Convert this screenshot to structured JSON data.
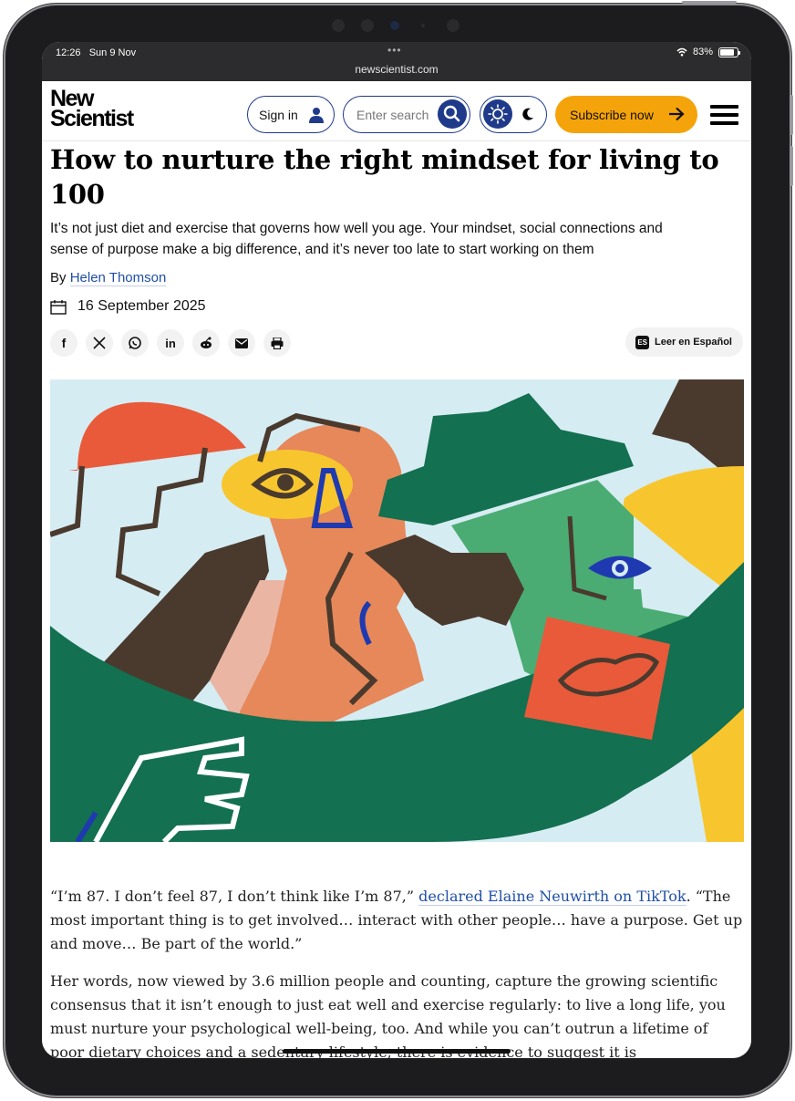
{
  "status_bar": {
    "time": "12:26",
    "date": "Sun 9 Nov",
    "battery": "83%",
    "battery_level": 0.83,
    "url": "newscientist.com"
  },
  "header": {
    "logo_line1": "New",
    "logo_line2": "Scientist",
    "sign_in": "Sign in",
    "search_placeholder": "Enter search",
    "subscribe": "Subscribe now"
  },
  "article": {
    "headline": "How to nurture the right mindset for living to 100",
    "standfirst": "It’s not just diet and exercise that governs how well you age. Your mindset, social connections and sense of purpose make a big difference, and it’s never too late to start working on them",
    "byline_prefix": "By",
    "author": "Helen Thomson",
    "date": "16 September 2025",
    "share_icons": [
      "facebook-icon",
      "x-icon",
      "whatsapp-icon",
      "linkedin-icon",
      "reddit-icon",
      "email-icon",
      "print-icon"
    ],
    "spanish_badge": "ES",
    "spanish_label": "Leer en Español",
    "para1_before": "“I’m 87. I don’t feel 87, I don’t think like I’m 87,”",
    "para1_link": "declared Elaine Neuwirth on TikTok",
    "para1_after": ". “The most important thing is to get involved… interact with other people… have a purpose. Get up and move… Be part of the world.”",
    "para2": "Her words, now viewed by 3.6 million people and counting, capture the growing scientific consensus that it isn’t enough to just eat well and exercise regularly: to live a long life, you must nurture your psychological well-being, too. And while you can’t outrun a lifetime of poor dietary choices and a sedentary lifestyle, there is evidence to suggest it is"
  },
  "colors": {
    "brand_blue": "#1f3a8a",
    "subscribe_orange": "#f5a30a",
    "link_blue": "#1f4fa8"
  }
}
